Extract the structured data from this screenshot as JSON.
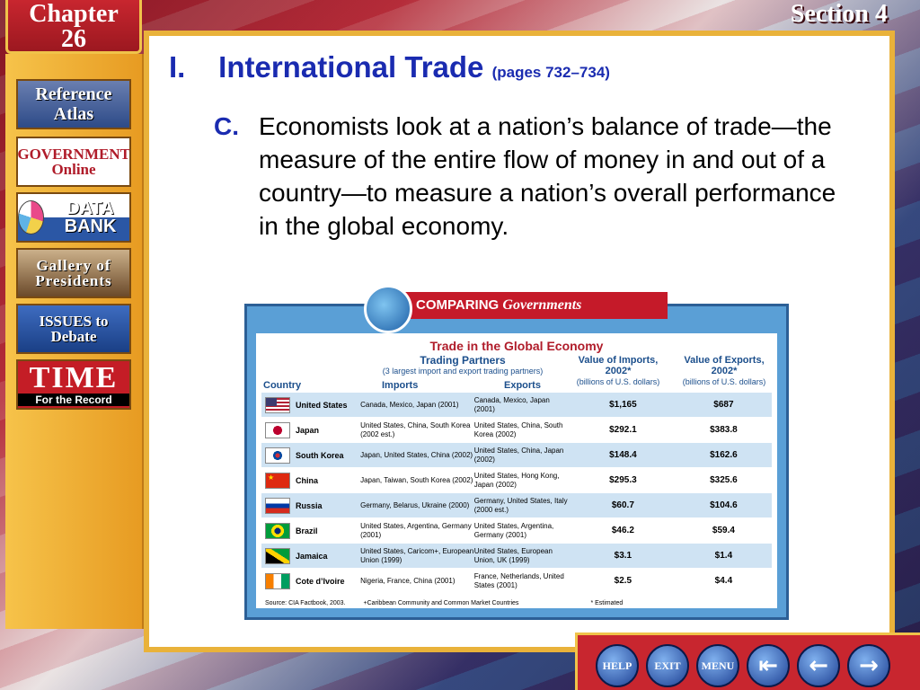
{
  "header": {
    "chapter_label": "Chapter",
    "chapter_number": "26",
    "section": "Section 4"
  },
  "sidebar": {
    "items": [
      {
        "label": "Reference Atlas",
        "icon": "atlas-icon"
      },
      {
        "label": "GOVERNMENT Online",
        "icon": "government-online-icon"
      },
      {
        "label": "DATA BANK",
        "icon": "pie-chart-icon"
      },
      {
        "label": "Gallery of Presidents",
        "icon": "presidents-icon"
      },
      {
        "label": "ISSUES to Debate",
        "icon": "debate-icon"
      },
      {
        "label": "TIME",
        "sublabel": "For the Record",
        "icon": "time-icon"
      }
    ]
  },
  "main": {
    "heading_num": "I.",
    "heading": "International Trade",
    "pages": "(pages 732–734)",
    "point_letter": "C.",
    "point_text": "Economists look at a nation’s balance of trade—the measure of the entire flow of money in and out of a country—to measure a nation’s overall performance in the global economy."
  },
  "table": {
    "badge": "COMPARING",
    "badge_italic": "Governments",
    "title": "Trade in the Global Economy",
    "col_country": "Country",
    "col_partners": "Trading Partners",
    "col_partners_sub": "(3 largest import and export trading partners)",
    "col_imports": "Imports",
    "col_exports": "Exports",
    "col_vimp": "Value of Imports, 2002*",
    "col_vimp_sub": "(billions of U.S. dollars)",
    "col_vexp": "Value of Exports, 2002*",
    "col_vexp_sub": "(billions of U.S. dollars)",
    "rows": [
      {
        "country": "United States",
        "imports": "Canada, Mexico, Japan (2001)",
        "exports": "Canada, Mexico, Japan (2001)",
        "vimp": "$1,165",
        "vexp": "$687"
      },
      {
        "country": "Japan",
        "imports": "United States, China, South Korea (2002 est.)",
        "exports": "United States, China, South Korea (2002)",
        "vimp": "$292.1",
        "vexp": "$383.8"
      },
      {
        "country": "South Korea",
        "imports": "Japan, United States, China (2002)",
        "exports": "United States, China, Japan (2002)",
        "vimp": "$148.4",
        "vexp": "$162.6"
      },
      {
        "country": "China",
        "imports": "Japan, Taiwan, South Korea (2002)",
        "exports": "United States, Hong Kong, Japan (2002)",
        "vimp": "$295.3",
        "vexp": "$325.6"
      },
      {
        "country": "Russia",
        "imports": "Germany, Belarus, Ukraine (2000)",
        "exports": "Germany, United States, Italy (2000 est.)",
        "vimp": "$60.7",
        "vexp": "$104.6"
      },
      {
        "country": "Brazil",
        "imports": "United States, Argentina, Germany (2001)",
        "exports": "United States, Argentina, Germany (2001)",
        "vimp": "$46.2",
        "vexp": "$59.4"
      },
      {
        "country": "Jamaica",
        "imports": "United States, Caricom+, European Union (1999)",
        "exports": "United States, European Union, UK (1999)",
        "vimp": "$3.1",
        "vexp": "$1.4"
      },
      {
        "country": "Cote d’Ivoire",
        "imports": "Nigeria, France, China (2001)",
        "exports": "France, Netherlands, United States (2001)",
        "vimp": "$2.5",
        "vexp": "$4.4"
      }
    ],
    "source": "Source: CIA Factbook, 2003.",
    "footnote1": "+Caribbean Community and Common Market Countries",
    "footnote2": "* Estimated"
  },
  "nav": {
    "help": "HELP",
    "exit": "EXIT",
    "menu": "MENU"
  }
}
